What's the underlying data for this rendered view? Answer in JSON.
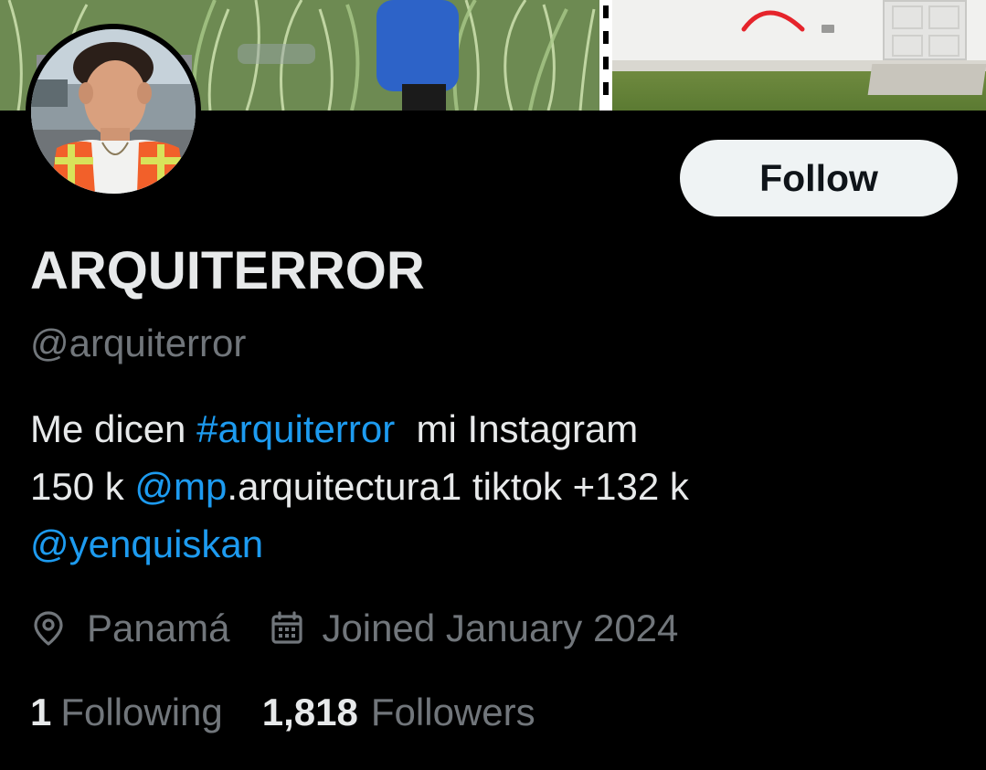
{
  "profile": {
    "display_name": "ARQUITERROR",
    "handle": "@arquiterror",
    "follow_label": "Follow"
  },
  "bio": {
    "line1_text": "Me dicen ",
    "hashtag": "#arquiterror",
    "line1_rest": "  mi Instagram",
    "line2_prefix": "150 k ",
    "mention1": "@mp",
    "line2_rest": ".arquitectura1 tiktok +132 k",
    "mention2": "@yenquiskan"
  },
  "meta": {
    "location_icon": "location-pin-icon",
    "location": "Panamá",
    "calendar_icon": "calendar-icon",
    "joined": "Joined January 2024"
  },
  "stats": {
    "following_count": "1",
    "following_label": "Following",
    "followers_count": "1,818",
    "followers_label": "Followers"
  },
  "colors": {
    "background": "#000000",
    "text_primary": "#e7e9ea",
    "text_secondary": "#71767b",
    "link": "#1d9bf0",
    "button_bg": "#eff3f4",
    "button_text": "#0f1419"
  }
}
